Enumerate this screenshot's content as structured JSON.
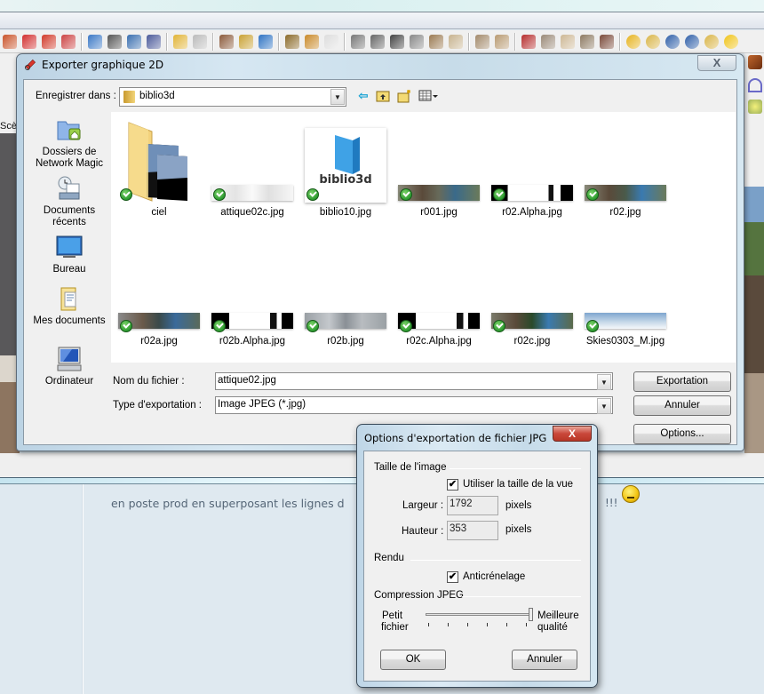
{
  "app": {
    "left_tab_label": "Scè",
    "forum_text": "en poste prod en superposant les lignes d",
    "forum_exclaim": "!!!",
    "toolbar_icons": [
      "push-pull-icon",
      "move-icon",
      "rotate-icon",
      "offset-icon",
      "orbit-icon",
      "pan-icon",
      "zoom-icon",
      "zoom-extents-icon",
      "get-models-icon",
      "share-model-icon",
      "add-location-icon",
      "toggle-terrain-icon",
      "google-earth-icon",
      "get-component-icon",
      "share-component-icon",
      "warehouse-icon",
      "iso-view-icon",
      "top-view-icon",
      "front-view-icon",
      "right-view-icon",
      "back-view-icon",
      "left-view-icon",
      "sandbox-from-contours-icon",
      "sandbox-from-scratch-icon",
      "smoove-icon",
      "stamp-icon",
      "drape-icon",
      "add-detail-icon",
      "flip-edge-icon",
      "plugin-m-icon",
      "plugin-tag-icon",
      "plugin-r-icon",
      "help-icon",
      "plugin-tag2-icon",
      "sphere-icon"
    ]
  },
  "export_dialog": {
    "title": "Exporter graphique 2D",
    "close_label": "X",
    "save_in_label": "Enregistrer dans :",
    "save_in_value": "biblio3d",
    "places": [
      {
        "label": "Dossiers de Network Magic",
        "icon": "network-magic-folder-icon"
      },
      {
        "label": "Documents récents",
        "icon": "recent-documents-icon"
      },
      {
        "label": "Bureau",
        "icon": "desktop-icon"
      },
      {
        "label": "Mes documents",
        "icon": "my-documents-icon"
      },
      {
        "label": "Ordinateur",
        "icon": "computer-icon"
      }
    ],
    "files": [
      {
        "name": "ciel",
        "type": "folder"
      },
      {
        "name": "attique02c.jpg",
        "type": "image"
      },
      {
        "name": "biblio10.jpg",
        "type": "image",
        "thumb_text": "biblio3d"
      },
      {
        "name": "r001.jpg",
        "type": "image"
      },
      {
        "name": "r02.Alpha.jpg",
        "type": "image"
      },
      {
        "name": "r02.jpg",
        "type": "image"
      },
      {
        "name": "r02a.jpg",
        "type": "image"
      },
      {
        "name": "r02b.Alpha.jpg",
        "type": "image"
      },
      {
        "name": "r02b.jpg",
        "type": "image"
      },
      {
        "name": "r02c.Alpha.jpg",
        "type": "image"
      },
      {
        "name": "r02c.jpg",
        "type": "image"
      },
      {
        "name": "Skies0303_M.jpg",
        "type": "image"
      }
    ],
    "filename_label": "Nom du fichier :",
    "filename_value": "attique02.jpg",
    "type_label": "Type d'exportation :",
    "type_value": "Image JPEG (*.jpg)",
    "export_button": "Exportation",
    "cancel_button": "Annuler",
    "options_button": "Options..."
  },
  "jpg_options": {
    "title": "Options d'exportation de fichier JPG",
    "close_label": "X",
    "image_size_group": "Taille de l'image",
    "use_view_size_label": "Utiliser la taille de la vue",
    "use_view_size_checked": true,
    "width_label": "Largeur :",
    "width_value": "1792",
    "width_unit": "pixels",
    "height_label": "Hauteur :",
    "height_value": "353",
    "height_unit": "pixels",
    "render_group": "Rendu",
    "antialias_label": "Anticrénelage",
    "antialias_checked": true,
    "compression_group": "Compression JPEG",
    "slider_left_label_1": "Petit",
    "slider_left_label_2": "fichier",
    "slider_right_label_1": "Meilleure",
    "slider_right_label_2": "qualité",
    "compression_quality_fraction": 1.0,
    "ok_button": "OK",
    "cancel_button": "Annuler"
  }
}
